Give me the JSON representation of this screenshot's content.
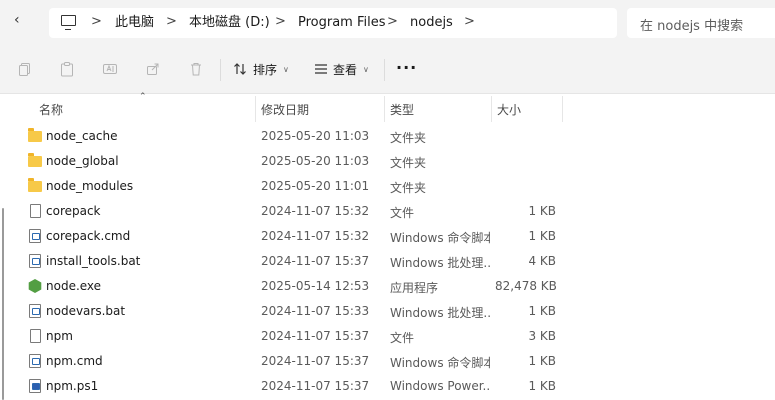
{
  "address_bar": {
    "breadcrumbs": [
      "此电脑",
      "本地磁盘 (D:)",
      "Program Files",
      "nodejs"
    ],
    "separator": ">",
    "search_placeholder": "在 nodejs 中搜索"
  },
  "toolbar": {
    "icons": [
      "copy-icon",
      "paste-icon",
      "rename-icon",
      "share-icon",
      "delete-icon"
    ],
    "sort_label": "排序",
    "view_label": "查看",
    "more_label": "···"
  },
  "columns": {
    "name": "名称",
    "date": "修改日期",
    "type": "类型",
    "size": "大小"
  },
  "files": [
    {
      "name": "node_cache",
      "date": "2025-05-20 11:03",
      "type": "文件夹",
      "size": "",
      "icon": "folder-icon"
    },
    {
      "name": "node_global",
      "date": "2025-05-20 11:03",
      "type": "文件夹",
      "size": "",
      "icon": "folder-icon"
    },
    {
      "name": "node_modules",
      "date": "2025-05-20 11:01",
      "type": "文件夹",
      "size": "",
      "icon": "folder-icon"
    },
    {
      "name": "corepack",
      "date": "2024-11-07 15:32",
      "type": "文件",
      "size": "1 KB",
      "icon": "file-icon"
    },
    {
      "name": "corepack.cmd",
      "date": "2024-11-07 15:32",
      "type": "Windows 命令脚本",
      "size": "1 KB",
      "icon": "script-icon"
    },
    {
      "name": "install_tools.bat",
      "date": "2024-11-07 15:37",
      "type": "Windows 批处理...",
      "size": "4 KB",
      "icon": "script-icon"
    },
    {
      "name": "node.exe",
      "date": "2025-05-14 12:53",
      "type": "应用程序",
      "size": "82,478 KB",
      "icon": "node-icon"
    },
    {
      "name": "nodevars.bat",
      "date": "2024-11-07 15:33",
      "type": "Windows 批处理...",
      "size": "1 KB",
      "icon": "script-icon"
    },
    {
      "name": "npm",
      "date": "2024-11-07 15:37",
      "type": "文件",
      "size": "3 KB",
      "icon": "file-icon"
    },
    {
      "name": "npm.cmd",
      "date": "2024-11-07 15:37",
      "type": "Windows 命令脚本",
      "size": "1 KB",
      "icon": "script-icon"
    },
    {
      "name": "npm.ps1",
      "date": "2024-11-07 15:37",
      "type": "Windows Power...",
      "size": "1 KB",
      "icon": "powershell-icon"
    }
  ]
}
